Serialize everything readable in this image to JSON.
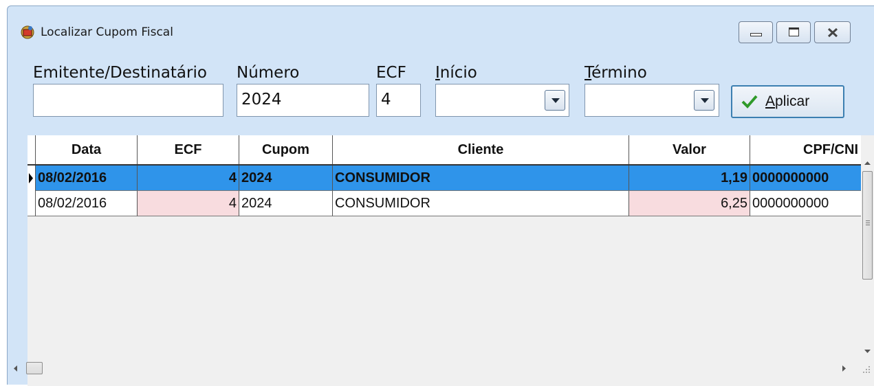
{
  "window": {
    "title": "Localizar Cupom Fiscal"
  },
  "filters": {
    "emitente": {
      "label": "Emitente/Destinatário",
      "value": ""
    },
    "numero": {
      "label": "Número",
      "value": "2024"
    },
    "ecf": {
      "label": "ECF",
      "value": "4"
    },
    "inicio": {
      "label_accel": "I",
      "label_rest": "nício",
      "value": ""
    },
    "termino": {
      "label_accel": "T",
      "label_rest": "érmino",
      "value": ""
    },
    "apply": {
      "label_accel": "A",
      "label_rest": "plicar"
    }
  },
  "grid": {
    "columns": [
      "Data",
      "ECF",
      "Cupom",
      "Cliente",
      "Valor",
      "CPF/CNI"
    ],
    "rows": [
      {
        "data": "08/02/2016",
        "ecf": "4",
        "cupom": "2024",
        "cliente": "CONSUMIDOR",
        "valor": "1,19",
        "cpf": "0000000000",
        "selected": true
      },
      {
        "data": "08/02/2016",
        "ecf": "4",
        "cupom": "2024",
        "cliente": "CONSUMIDOR",
        "valor": "6,25",
        "cpf": "0000000000",
        "selected": false
      }
    ]
  },
  "colors": {
    "selection": "#2f94ea",
    "alt_cell": "#f8dcdf",
    "window_bg": "#d2e4f7"
  }
}
